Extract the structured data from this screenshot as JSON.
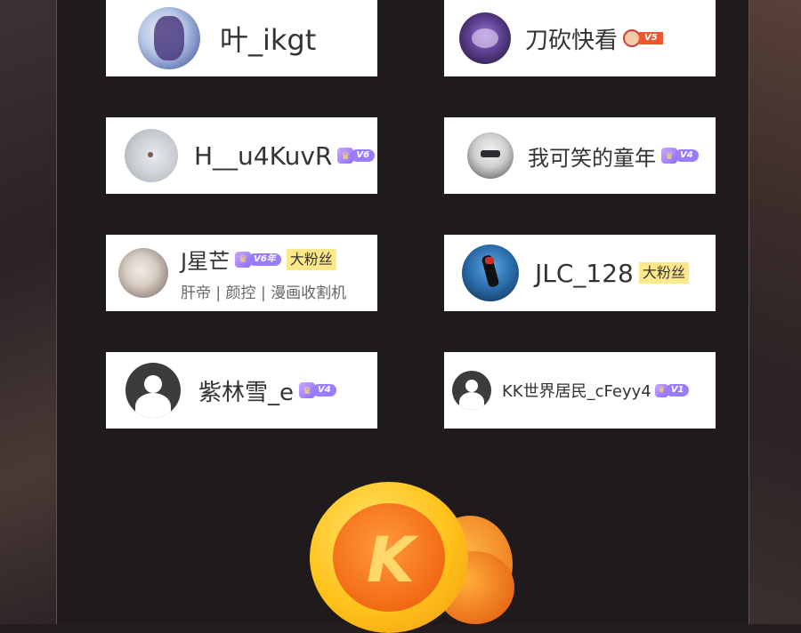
{
  "fans": [
    {
      "name": "叶_ikgt"
    },
    {
      "name": "刀砍快看",
      "badge": "V5"
    },
    {
      "name": "H__u4KuvR",
      "badge": "V6"
    },
    {
      "name": "我可笑的童年",
      "badge": "V4"
    },
    {
      "name": "J星芒",
      "badge": "V6年",
      "tag": "大粉丝",
      "subtitle": "肝帝 | 颜控 | 漫画收割机"
    },
    {
      "name": "JLC_128",
      "tag": "大粉丝"
    },
    {
      "name": "紫林雪_e",
      "badge": "V4"
    },
    {
      "name": "KK世界居民_cFeyy4",
      "badge": "V1"
    }
  ],
  "coin": {
    "letter": "K"
  },
  "colors": {
    "panel_border": "#a5362c",
    "fan_tag_bg": "#ffe88a",
    "vip_purple": "#9a7cff",
    "coin_orange": "#f08a1c"
  }
}
